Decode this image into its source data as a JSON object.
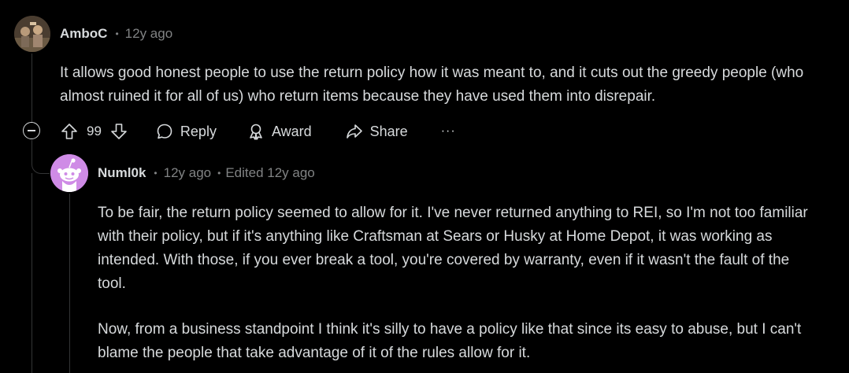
{
  "parent_comment": {
    "author": "AmboC",
    "age": "12y ago",
    "body": "It allows good honest people to use the return policy how it was meant to, and it cuts out the greedy people (who almost ruined it for all of us) who return items because they have used them into disrepair.",
    "score": "99",
    "actions": {
      "reply": "Reply",
      "award": "Award",
      "share": "Share",
      "more": "···"
    }
  },
  "reply_comment": {
    "author": "Numl0k",
    "age": "12y ago",
    "edited": "Edited 12y ago",
    "paragraphs": [
      "To be fair, the return policy seemed to allow for it. I've never returned anything to REI, so I'm not too familiar with their policy, but if it's anything like Craftsman at Sears or Husky at Home Depot, it was working as intended. With those, if you ever break a tool, you're covered by warranty, even if it wasn't the fault of the tool.",
      "Now, from a business standpoint I think it's silly to have a policy like that since its easy to abuse, but I can't blame the people that take advantage of it of the rules allow for it."
    ]
  },
  "colors": {
    "background": "#000000",
    "text": "#d7dadc",
    "muted": "#818384",
    "thread_line": "#343536",
    "default_avatar_bg": "#cf8be6"
  },
  "icons": [
    "upvote-icon",
    "downvote-icon",
    "comment-icon",
    "award-icon",
    "share-icon",
    "collapse-icon",
    "snoo-avatar-icon"
  ]
}
